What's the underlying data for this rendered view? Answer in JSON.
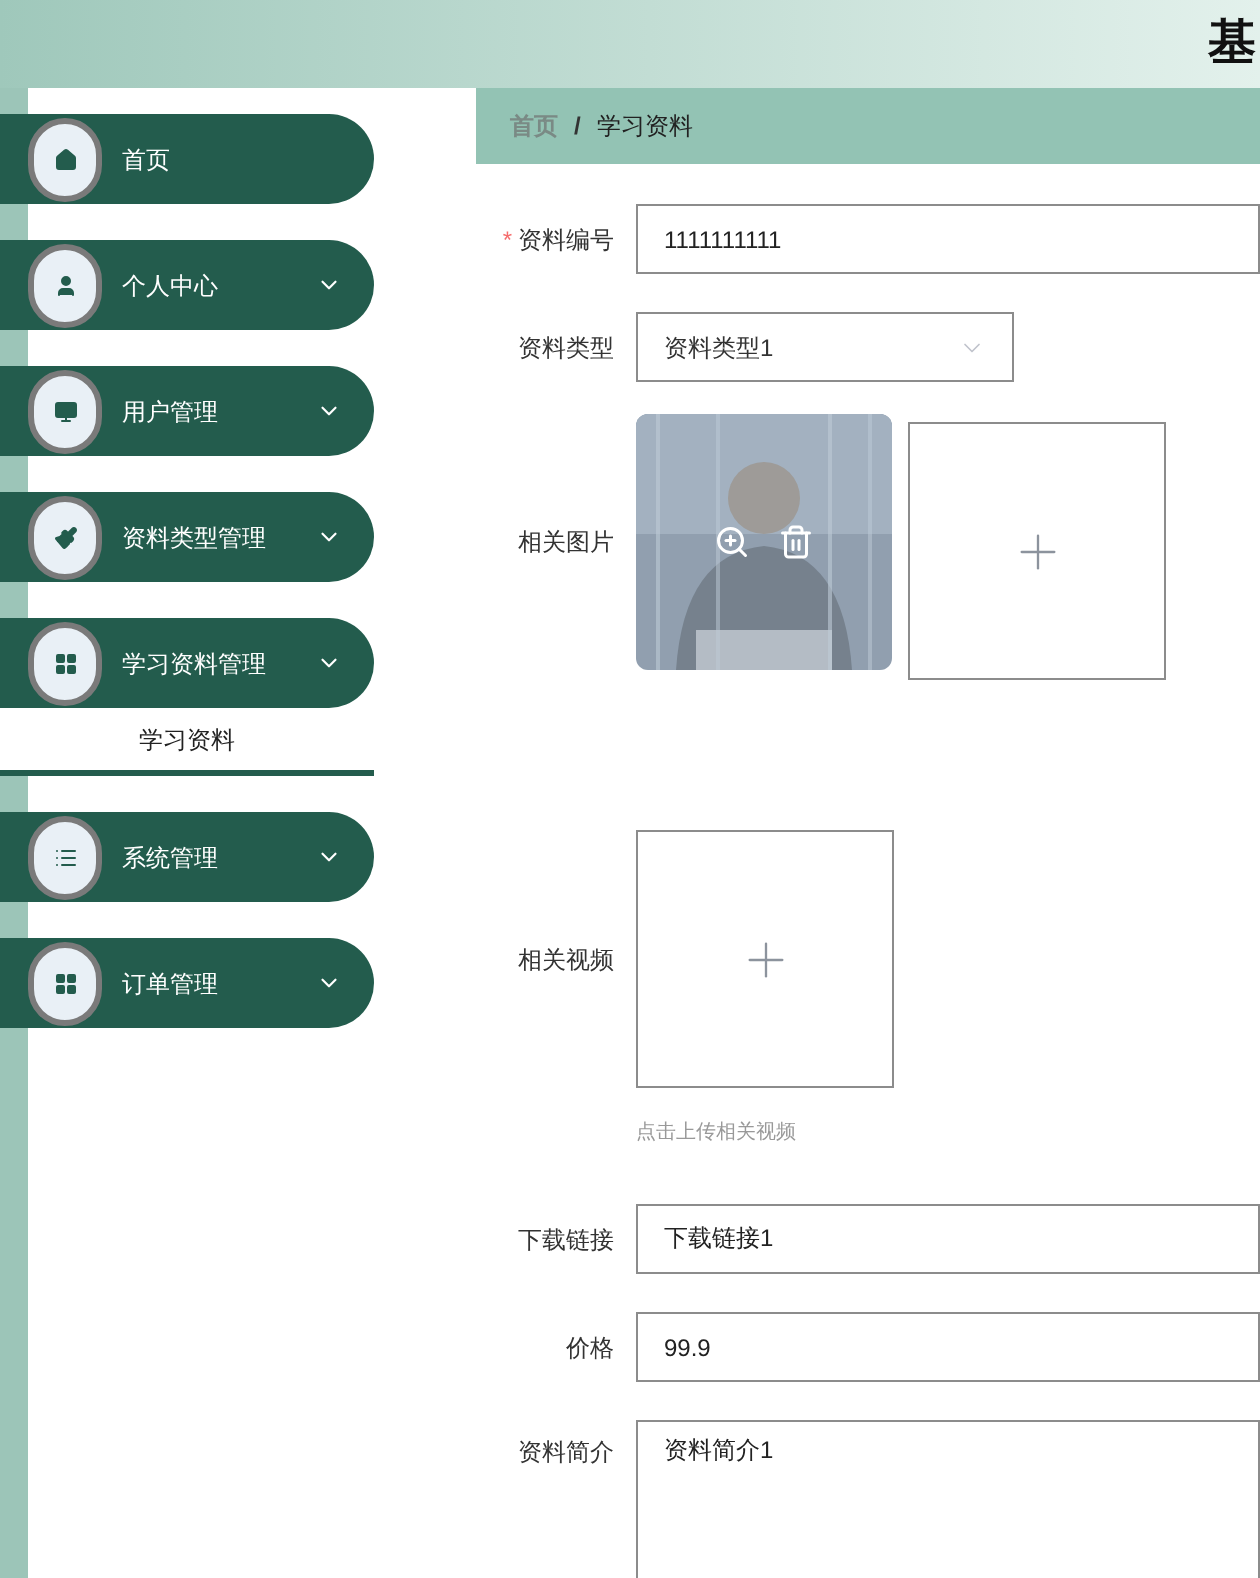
{
  "header": {
    "title": "基"
  },
  "sidebar": {
    "items": [
      {
        "label": "首页",
        "kind": "link"
      },
      {
        "label": "个人中心",
        "kind": "submenu"
      },
      {
        "label": "用户管理",
        "kind": "submenu"
      },
      {
        "label": "资料类型管理",
        "kind": "submenu"
      },
      {
        "label": "学习资料管理",
        "kind": "submenu",
        "children": [
          {
            "label": "学习资料",
            "selected": true
          }
        ]
      },
      {
        "label": "系统管理",
        "kind": "submenu"
      },
      {
        "label": "订单管理",
        "kind": "submenu"
      }
    ]
  },
  "breadcrumb": [
    {
      "label": "首页"
    },
    {
      "label": "学习资料",
      "separator": "/"
    }
  ],
  "form": {
    "fields": [
      {
        "kind": "input",
        "label": "资料编号",
        "required_mark": "*",
        "value": "1111111111"
      },
      {
        "kind": "select",
        "label": "资料类型",
        "value": "资料类型1"
      },
      {
        "kind": "image_upload",
        "label": "相关图片"
      },
      {
        "kind": "video_upload",
        "label": "相关视频",
        "hint": "点击上传相关视频"
      },
      {
        "kind": "input",
        "label": "下载链接",
        "value": "下载链接1"
      },
      {
        "kind": "input",
        "label": "价格",
        "value": "99.9"
      },
      {
        "kind": "textarea",
        "label": "资料简介",
        "value": "资料简介1"
      }
    ]
  }
}
